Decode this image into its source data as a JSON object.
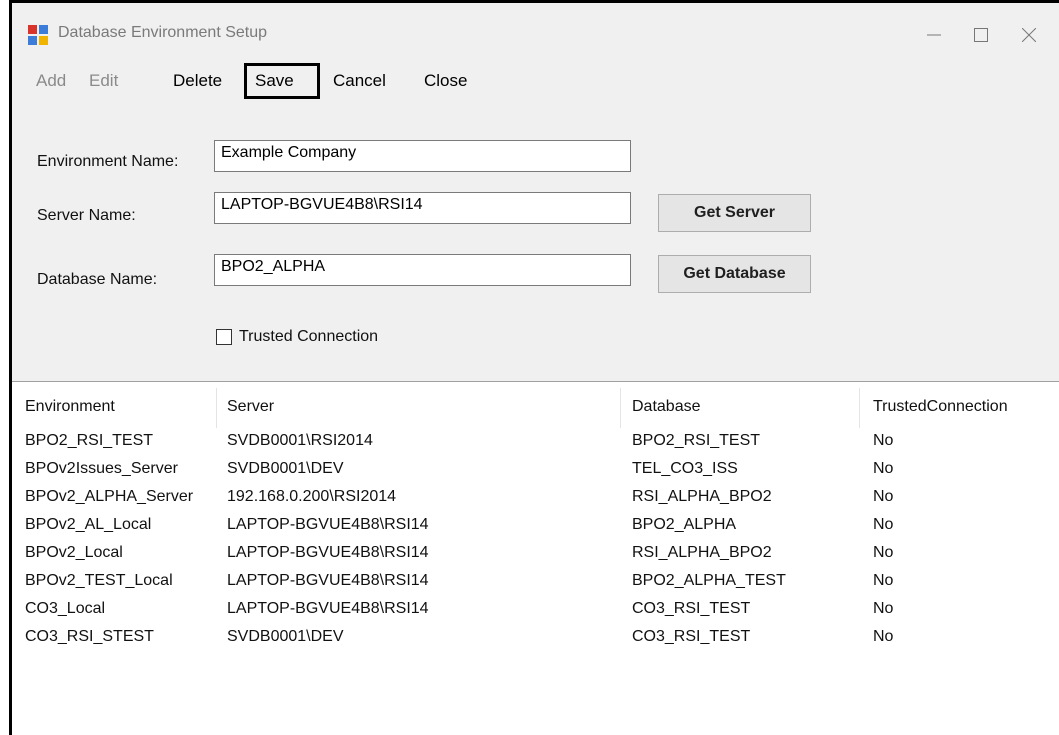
{
  "window": {
    "title": "Database Environment Setup"
  },
  "menu": {
    "add": "Add",
    "edit": "Edit",
    "delete": "Delete",
    "save": "Save",
    "cancel": "Cancel",
    "close": "Close"
  },
  "form": {
    "environment_label": "Environment Name:",
    "environment_value": "Example Company",
    "server_label": "Server Name:",
    "server_value": "LAPTOP-BGVUE4B8\\RSI14",
    "database_label": "Database Name:",
    "database_value": "BPO2_ALPHA",
    "get_server": "Get Server",
    "get_database": "Get Database",
    "trusted_label": "Trusted Connection",
    "trusted_checked": false
  },
  "grid": {
    "columns": [
      "Environment",
      "Server",
      "Database",
      "TrustedConnection"
    ],
    "rows": [
      [
        "BPO2_RSI_TEST",
        "SVDB0001\\RSI2014",
        "BPO2_RSI_TEST",
        "No"
      ],
      [
        "BPOv2Issues_Server",
        "SVDB0001\\DEV",
        "TEL_CO3_ISS",
        "No"
      ],
      [
        "BPOv2_ALPHA_Server",
        "192.168.0.200\\RSI2014",
        "RSI_ALPHA_BPO2",
        "No"
      ],
      [
        "BPOv2_AL_Local",
        "LAPTOP-BGVUE4B8\\RSI14",
        "BPO2_ALPHA",
        "No"
      ],
      [
        "BPOv2_Local",
        "LAPTOP-BGVUE4B8\\RSI14",
        "RSI_ALPHA_BPO2",
        "No"
      ],
      [
        "BPOv2_TEST_Local",
        "LAPTOP-BGVUE4B8\\RSI14",
        "BPO2_ALPHA_TEST",
        "No"
      ],
      [
        "CO3_Local",
        "LAPTOP-BGVUE4B8\\RSI14",
        "CO3_RSI_TEST",
        "No"
      ],
      [
        "CO3_RSI_STEST",
        "SVDB0001\\DEV",
        "CO3_RSI_TEST",
        "No"
      ]
    ]
  },
  "icons": {
    "app": "app-window-icon",
    "minimize": "minimize-icon",
    "maximize": "maximize-icon",
    "close": "close-icon"
  }
}
